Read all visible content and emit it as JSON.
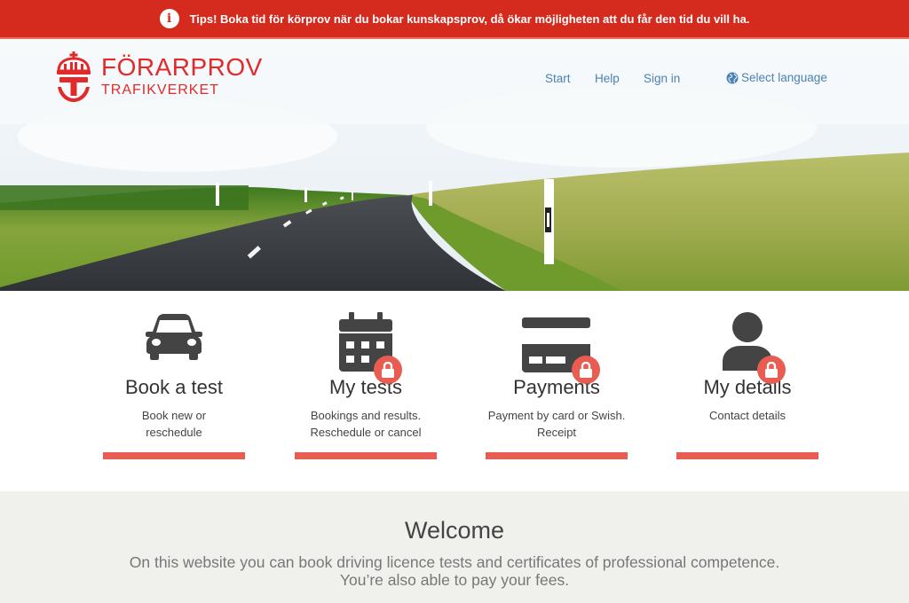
{
  "tips": {
    "icon": "info-icon",
    "text": "Tips! Boka tid för körprov när du bokar kunskapsprov, då ökar möjligheten att du får den tid du vill ha."
  },
  "header": {
    "logo": {
      "icon": "crown-t-icon",
      "title": "FÖRARPROV",
      "subtitle": "TRAFIKVERKET"
    },
    "nav": {
      "start": "Start",
      "help": "Help",
      "sign_in": "Sign in",
      "language": "Select language",
      "language_icon": "globe-icon"
    }
  },
  "cards": [
    {
      "title": "Book a test",
      "desc_line1": "Book new or",
      "desc_line2": "reschedule",
      "icon": "car-icon",
      "locked": false
    },
    {
      "title": "My tests",
      "desc_line1": "Bookings and results.",
      "desc_line2": "Reschedule or cancel",
      "icon": "calendar-icon",
      "locked": true
    },
    {
      "title": "Payments",
      "desc_line1": "Payment by card or Swish.",
      "desc_line2": "Receipt",
      "icon": "credit-card-icon",
      "locked": true
    },
    {
      "title": "My details",
      "desc_line1": "Contact details",
      "desc_line2": "",
      "icon": "user-icon",
      "locked": true
    }
  ],
  "welcome": {
    "title": "Welcome",
    "line1": "On this website you can book driving licence tests and certificates of professional competence.",
    "line2": "You’re also able to pay your fees."
  },
  "colors": {
    "tips_bg": "#d52b1e",
    "brand_red": "#e22a2a",
    "nav_link": "#4b82b4",
    "accent_bar": "#e85c51",
    "icon_dark": "#444444",
    "welcome_bg": "#f0f1ec"
  }
}
